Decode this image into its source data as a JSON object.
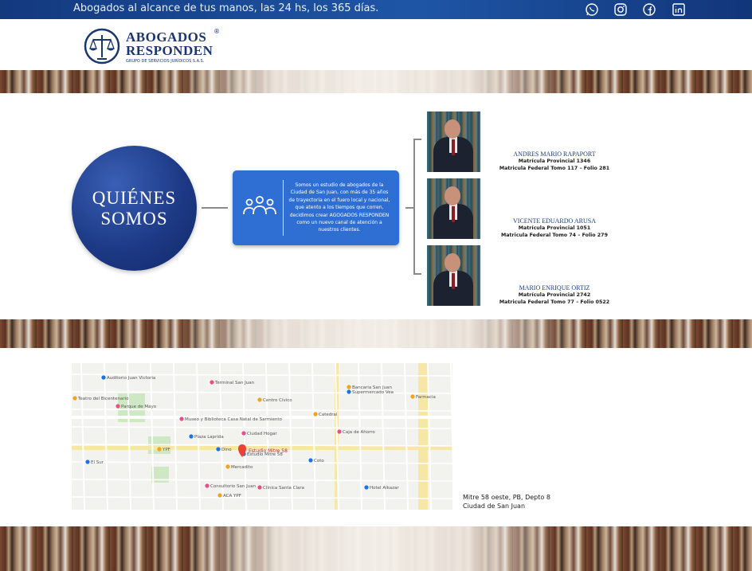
{
  "topbar": {
    "tagline": "Abogados al alcance de tus manos, las 24 hs, los 365 días.",
    "social_icons": [
      "whatsapp-icon",
      "instagram-icon",
      "facebook-icon",
      "linkedin-icon"
    ]
  },
  "logo": {
    "line1": "ABOGADOS",
    "line2": "RESPONDEN",
    "registered": "®",
    "subline": "GRUPO DE SERVICIOS JURÍDICOS S.A.S."
  },
  "about": {
    "title_line1": "QUIÉNES",
    "title_line2": "SOMOS",
    "description": "Somos un estudio de abogados de la Ciudad de San Juan, con más de 35 años de trayectoria en el fuero local y nacional, que atento a los tiempos que corren, decidimos crear AGOGADOS RESPONDEN como un nuevo canal de atención a nuestros clientes.",
    "members": [
      {
        "name": "ANDRES MARIO RAPAPORT",
        "line1": "Matrícula Provincial 1346",
        "line2": "Matricula Federal Tomo 117 – Folio 281"
      },
      {
        "name": "VICENTE EDUARDO ARUSA",
        "line1": "Matrícula Provincial 1051",
        "line2": "Matricula Federal Tomo 74 – Folio 279"
      },
      {
        "name": "MARIO ENRIQUE ORTIZ",
        "line1": "Matrícula Provincial 2742",
        "line2": "Matricula Federal Tomo 77 – Folio 0522"
      }
    ]
  },
  "map": {
    "labels": [
      "Auditorio Juan Victoria",
      "Teatro del Bicentenario",
      "Terminal San Juan",
      "Supermercado Vea",
      "Centro Cívico",
      "Museo y Biblioteca Casa Natal de Sarmiento",
      "Plaza Laprida",
      "Catedral",
      "Parque de Mayo",
      "Coto",
      "Mercadito",
      "Caja de Ahorro",
      "El Sur",
      "Bancaria San Juan",
      "Consultorio San Juan",
      "Dino",
      "YPF",
      "Clínica Santa Clara",
      "Hotel Alkazar",
      "Farmacia",
      "Ciudad Hogar",
      "Estudio Mitre 58",
      "ACA YPF"
    ],
    "pin_label": "Estudio Mitre 58"
  },
  "address": {
    "line1": "Mitre 58 oeste, PB, Depto 8",
    "line2": "Ciudad de San Juan"
  },
  "colors": {
    "brand_dark": "#1a3570",
    "brand_blue": "#2f6fd3",
    "topbar": "#1e56a6"
  }
}
